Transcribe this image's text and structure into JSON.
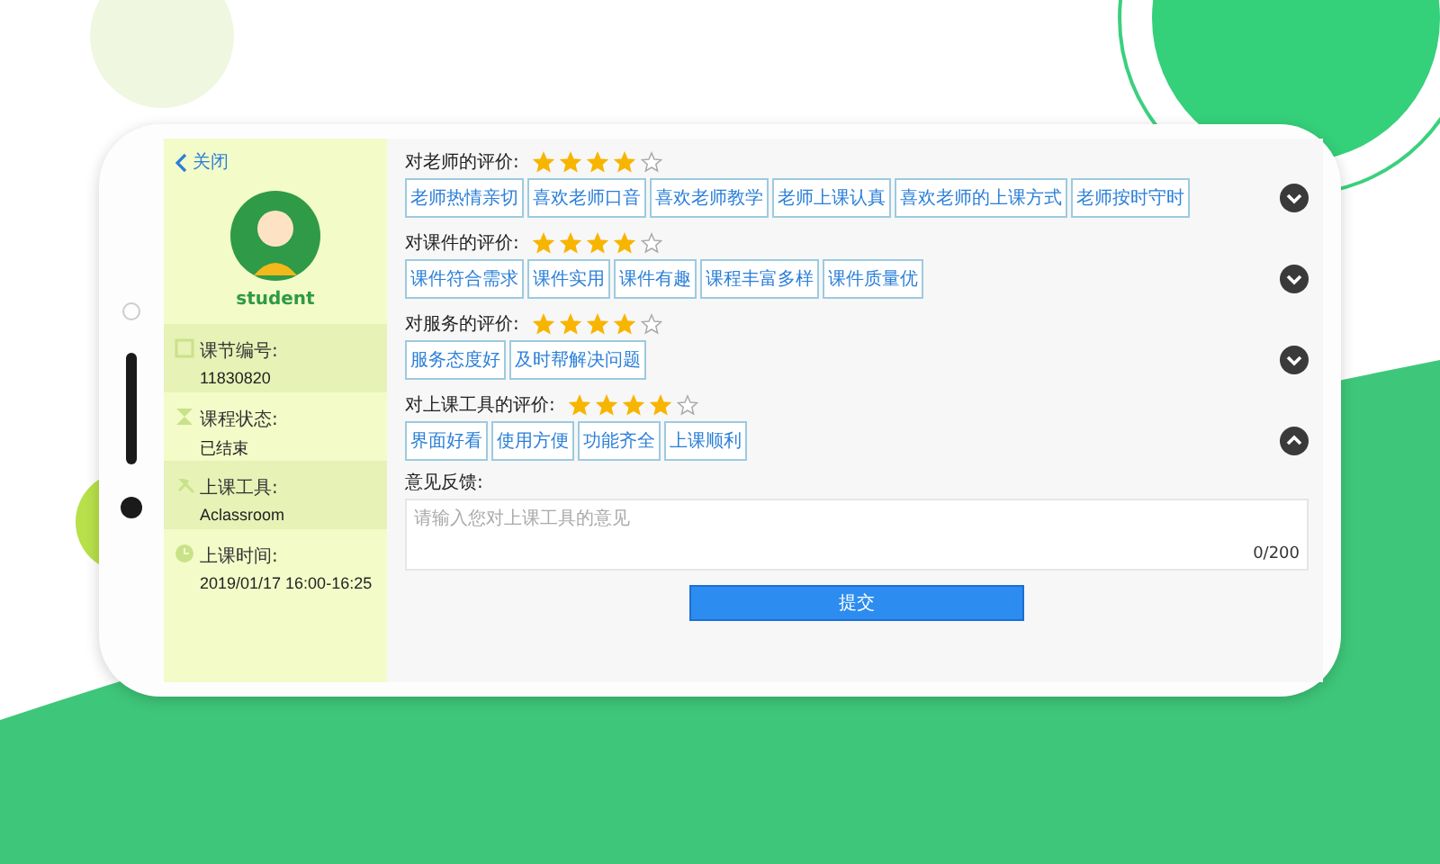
{
  "sidebar": {
    "back_label": "关闭",
    "username": "student",
    "info": [
      {
        "label": "课节编号:",
        "value": "11830820"
      },
      {
        "label": "课程状态:",
        "value": "已结束"
      },
      {
        "label": "上课工具:",
        "value": "Aclassroom"
      },
      {
        "label": "上课时间:",
        "value": "2019/01/17 16:00-16:25"
      }
    ]
  },
  "ratings": [
    {
      "title": "对老师的评价:",
      "stars": 4,
      "expanded": false,
      "tags": [
        "老师热情亲切",
        "喜欢老师口音",
        "喜欢老师教学",
        "老师上课认真",
        "喜欢老师的上课方式",
        "老师按时守时"
      ]
    },
    {
      "title": "对课件的评价:",
      "stars": 4,
      "expanded": false,
      "tags": [
        "课件符合需求",
        "课件实用",
        "课件有趣",
        "课程丰富多样",
        "课件质量优"
      ]
    },
    {
      "title": "对服务的评价:",
      "stars": 4,
      "expanded": false,
      "tags": [
        "服务态度好",
        "及时帮解决问题"
      ]
    },
    {
      "title": "对上课工具的评价:",
      "stars": 4,
      "expanded": true,
      "tags": [
        "界面好看",
        "使用方便",
        "功能齐全",
        "上课顺利"
      ]
    }
  ],
  "feedback": {
    "label": "意见反馈:",
    "placeholder": "请输入您对上课工具的意见",
    "counter": "0/200"
  },
  "submit": "提交"
}
